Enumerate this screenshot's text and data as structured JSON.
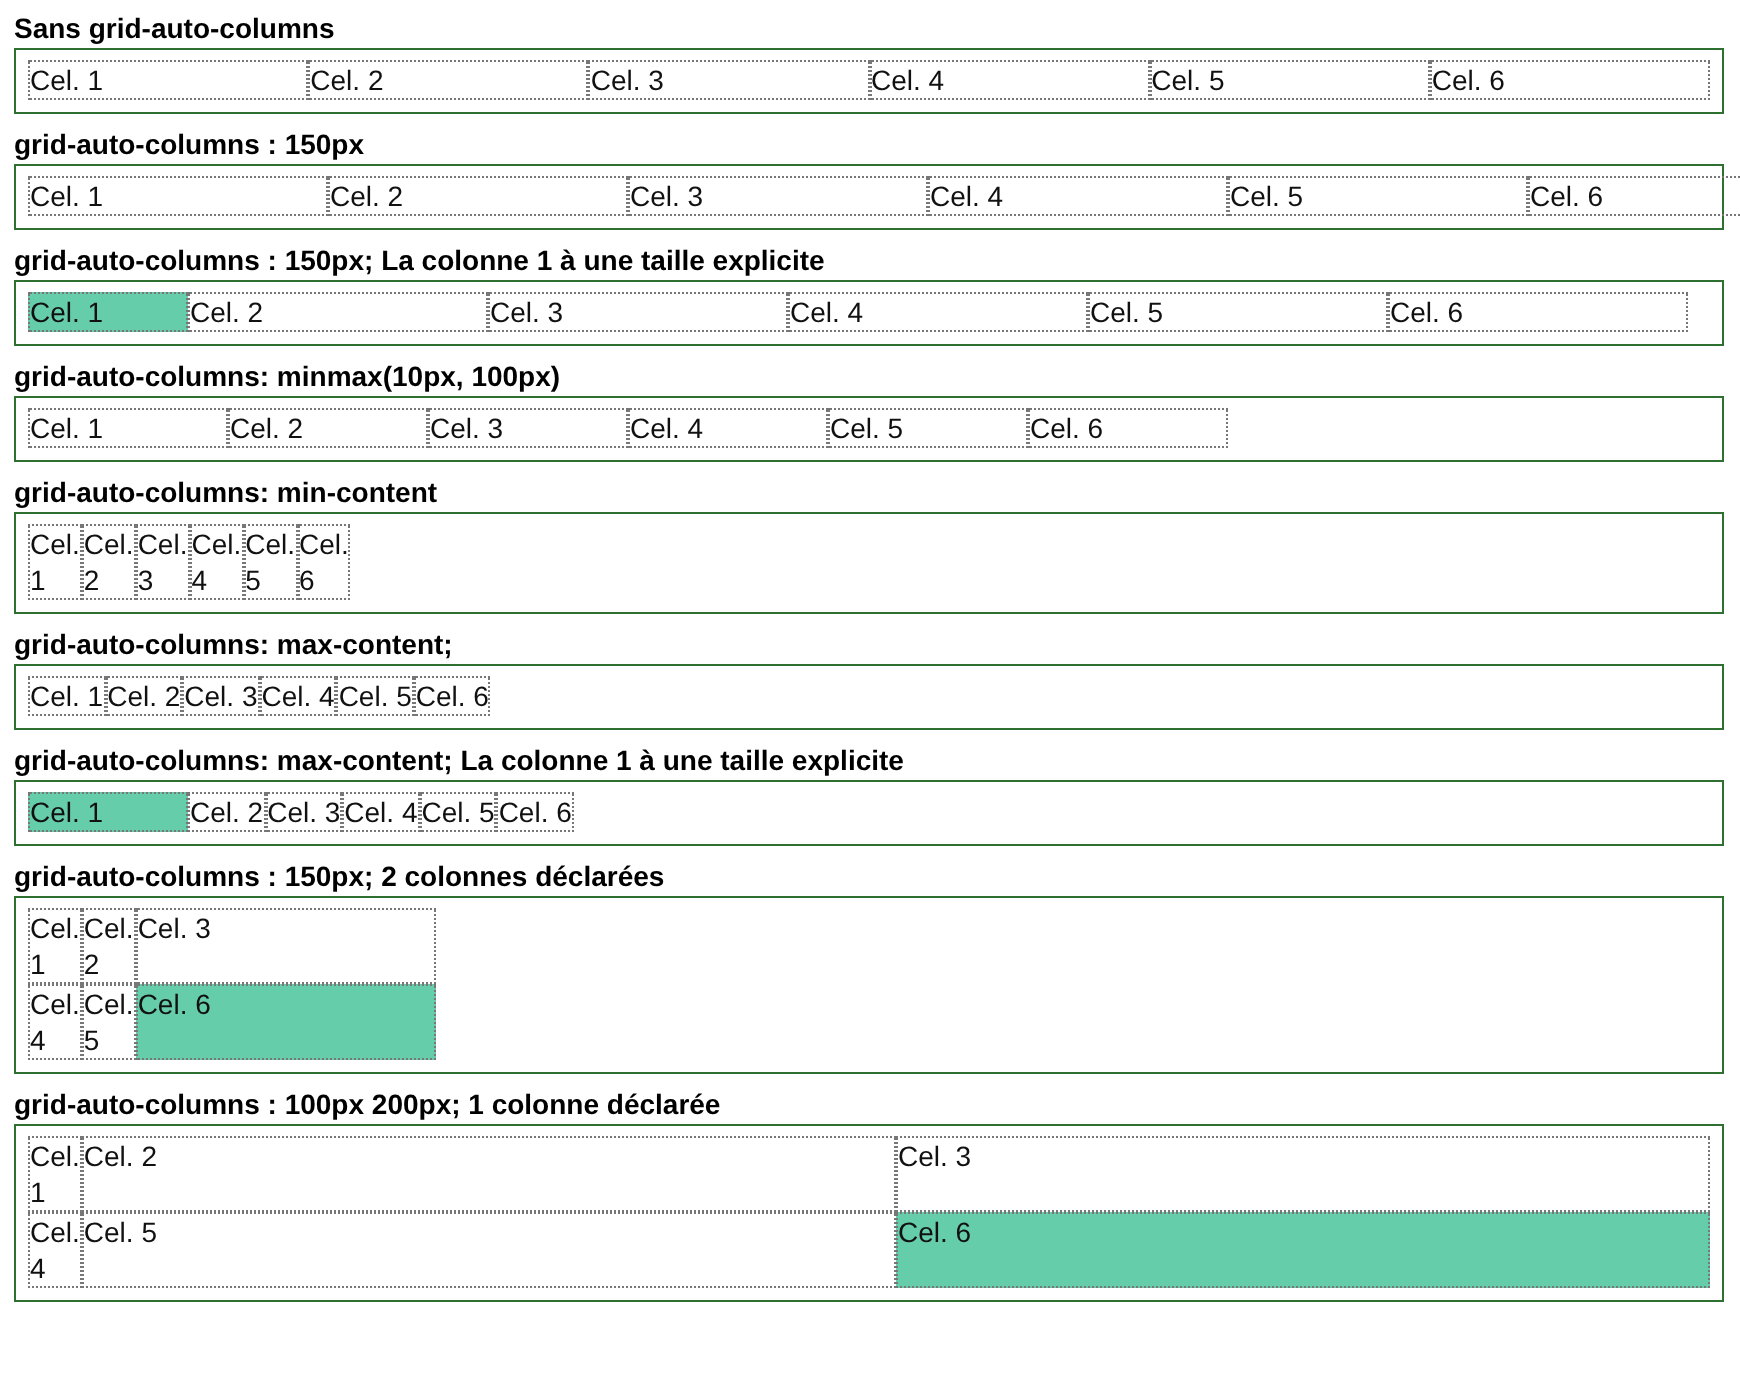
{
  "examples": [
    {
      "title": "Sans grid-auto-columns",
      "kind": "equal",
      "cells": [
        {
          "text": "Cel. 1",
          "highlighted": false
        },
        {
          "text": "Cel. 2",
          "highlighted": false
        },
        {
          "text": "Cel. 3",
          "highlighted": false
        },
        {
          "text": "Cel. 4",
          "highlighted": false
        },
        {
          "text": "Cel. 5",
          "highlighted": false
        },
        {
          "text": "Cel. 6",
          "highlighted": false
        }
      ]
    },
    {
      "title": "grid-auto-columns : 150px",
      "kind": "fixed",
      "cells": [
        {
          "text": "Cel. 1",
          "highlighted": false
        },
        {
          "text": "Cel. 2",
          "highlighted": false
        },
        {
          "text": "Cel. 3",
          "highlighted": false
        },
        {
          "text": "Cel. 4",
          "highlighted": false
        },
        {
          "text": "Cel. 5",
          "highlighted": false
        },
        {
          "text": "Cel. 6",
          "highlighted": false
        }
      ]
    },
    {
      "title": "grid-auto-columns : 150px; La colonne 1 à une taille explicite",
      "kind": "fixed-first",
      "cells": [
        {
          "text": "Cel. 1",
          "highlighted": true
        },
        {
          "text": "Cel. 2",
          "highlighted": false
        },
        {
          "text": "Cel. 3",
          "highlighted": false
        },
        {
          "text": "Cel. 4",
          "highlighted": false
        },
        {
          "text": "Cel. 5",
          "highlighted": false
        },
        {
          "text": "Cel. 6",
          "highlighted": false
        }
      ]
    },
    {
      "title": "grid-auto-columns: minmax(10px, 100px)",
      "kind": "minmax",
      "cells": [
        {
          "text": "Cel. 1",
          "highlighted": false
        },
        {
          "text": "Cel. 2",
          "highlighted": false
        },
        {
          "text": "Cel. 3",
          "highlighted": false
        },
        {
          "text": "Cel. 4",
          "highlighted": false
        },
        {
          "text": "Cel. 5",
          "highlighted": false
        },
        {
          "text": "Cel. 6",
          "highlighted": false
        }
      ]
    },
    {
      "title": "grid-auto-columns: min-content",
      "kind": "min-content",
      "cells": [
        {
          "text": "Cel. 1",
          "highlighted": false
        },
        {
          "text": "Cel. 2",
          "highlighted": false
        },
        {
          "text": "Cel. 3",
          "highlighted": false
        },
        {
          "text": "Cel. 4",
          "highlighted": false
        },
        {
          "text": "Cel. 5",
          "highlighted": false
        },
        {
          "text": "Cel. 6",
          "highlighted": false
        }
      ]
    },
    {
      "title": "grid-auto-columns: max-content;",
      "kind": "max-content",
      "cells": [
        {
          "text": "Cel. 1",
          "highlighted": false
        },
        {
          "text": "Cel. 2",
          "highlighted": false
        },
        {
          "text": "Cel. 3",
          "highlighted": false
        },
        {
          "text": "Cel. 4",
          "highlighted": false
        },
        {
          "text": "Cel. 5",
          "highlighted": false
        },
        {
          "text": "Cel. 6",
          "highlighted": false
        }
      ]
    },
    {
      "title": "grid-auto-columns: max-content; La colonne 1 à une taille explicite",
      "kind": "max-content-first",
      "cells": [
        {
          "text": "Cel. 1",
          "highlighted": true
        },
        {
          "text": "Cel. 2",
          "highlighted": false
        },
        {
          "text": "Cel. 3",
          "highlighted": false
        },
        {
          "text": "Cel. 4",
          "highlighted": false
        },
        {
          "text": "Cel. 5",
          "highlighted": false
        },
        {
          "text": "Cel. 6",
          "highlighted": false
        }
      ]
    },
    {
      "title": "grid-auto-columns : 150px; 2 colonnes déclarées",
      "kind": "two-declared",
      "cells": [
        {
          "text": "Cel. 1",
          "highlighted": false
        },
        {
          "text": "Cel. 2",
          "highlighted": false
        },
        {
          "text": "Cel. 3",
          "highlighted": false
        },
        {
          "text": "Cel. 4",
          "highlighted": false
        },
        {
          "text": "Cel. 5",
          "highlighted": false
        },
        {
          "text": "Cel. 6",
          "highlighted": true
        }
      ]
    },
    {
      "title": "grid-auto-columns : 100px 200px; 1 colonne déclarée",
      "kind": "one-declared",
      "cells": [
        {
          "text": "Cel. 1",
          "highlighted": false
        },
        {
          "text": "Cel. 2",
          "highlighted": false
        },
        {
          "text": "Cel. 3",
          "highlighted": false
        },
        {
          "text": "Cel. 4",
          "highlighted": false
        },
        {
          "text": "Cel. 5",
          "highlighted": false
        },
        {
          "text": "Cel. 6",
          "highlighted": true
        }
      ]
    }
  ]
}
